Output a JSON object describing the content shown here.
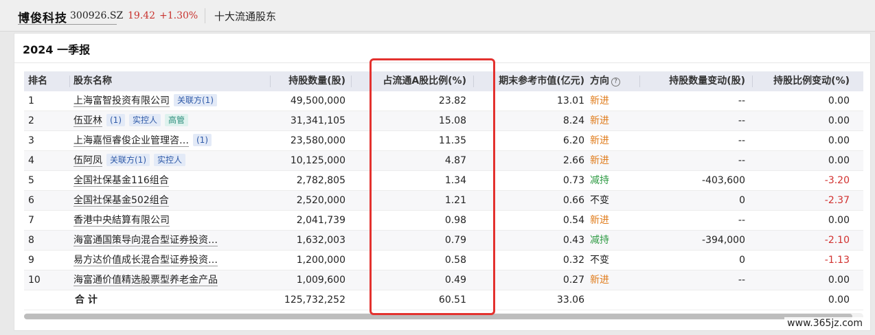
{
  "stock": {
    "name": "博俊科技",
    "code": "300926.SZ",
    "price": "19.42",
    "change": "+1.30%",
    "section": "十大流通股东"
  },
  "report": {
    "title": "2024 一季报"
  },
  "columns": {
    "rank": "排名",
    "name": "股东名称",
    "qty": "持股数量(股)",
    "pct": "占流通A股比例(%)",
    "mv": "期末参考市值(亿元)",
    "dir": "方向",
    "qchg": "持股数量变动(股)",
    "pchg": "持股比例变动(%)"
  },
  "rows": [
    {
      "rank": "1",
      "name": "上海富智投资有限公司",
      "tags": [
        {
          "text": "关联方(1)",
          "style": "blue"
        }
      ],
      "qty": "49,500,000",
      "pct": "23.82",
      "mv": "13.01",
      "dir": "新进",
      "dir_color": "#e07b1a",
      "qchg": "--",
      "pchg": "0.00",
      "pchg_neg": false
    },
    {
      "rank": "2",
      "name": "伍亚林",
      "tags": [
        {
          "text": "(1)",
          "style": "blue"
        },
        {
          "text": "实控人",
          "style": "blue"
        },
        {
          "text": "高管",
          "style": "teal"
        }
      ],
      "qty": "31,341,105",
      "pct": "15.08",
      "mv": "8.24",
      "dir": "新进",
      "dir_color": "#e07b1a",
      "qchg": "--",
      "pchg": "0.00",
      "pchg_neg": false
    },
    {
      "rank": "3",
      "name": "上海嘉恒睿俊企业管理咨…",
      "tags": [
        {
          "text": "(1)",
          "style": "blue"
        }
      ],
      "qty": "23,580,000",
      "pct": "11.35",
      "mv": "6.20",
      "dir": "新进",
      "dir_color": "#e07b1a",
      "qchg": "--",
      "pchg": "0.00",
      "pchg_neg": false
    },
    {
      "rank": "4",
      "name": "伍阿凤",
      "tags": [
        {
          "text": "关联方(1)",
          "style": "blue"
        },
        {
          "text": "实控人",
          "style": "blue"
        }
      ],
      "qty": "10,125,000",
      "pct": "4.87",
      "mv": "2.66",
      "dir": "新进",
      "dir_color": "#e07b1a",
      "qchg": "--",
      "pchg": "0.00",
      "pchg_neg": false
    },
    {
      "rank": "5",
      "name": "全国社保基金116组合",
      "tags": [],
      "qty": "2,782,805",
      "pct": "1.34",
      "mv": "0.73",
      "dir": "减持",
      "dir_color": "#2e9a43",
      "qchg": "-403,600",
      "pchg": "-3.20",
      "pchg_neg": true
    },
    {
      "rank": "6",
      "name": "全国社保基金502组合",
      "tags": [],
      "qty": "2,520,000",
      "pct": "1.21",
      "mv": "0.66",
      "dir": "不变",
      "dir_color": "#222222",
      "qchg": "0",
      "pchg": "-2.37",
      "pchg_neg": true
    },
    {
      "rank": "7",
      "name": "香港中央結算有限公司",
      "tags": [],
      "qty": "2,041,739",
      "pct": "0.98",
      "mv": "0.54",
      "dir": "新进",
      "dir_color": "#e07b1a",
      "qchg": "--",
      "pchg": "0.00",
      "pchg_neg": false
    },
    {
      "rank": "8",
      "name": "海富通国策导向混合型证券投资…",
      "tags": [],
      "qty": "1,632,003",
      "pct": "0.79",
      "mv": "0.43",
      "dir": "减持",
      "dir_color": "#2e9a43",
      "qchg": "-394,000",
      "pchg": "-2.10",
      "pchg_neg": true
    },
    {
      "rank": "9",
      "name": "易方达价值成长混合型证券投资…",
      "tags": [],
      "qty": "1,200,000",
      "pct": "0.58",
      "mv": "0.32",
      "dir": "不变",
      "dir_color": "#222222",
      "qchg": "0",
      "pchg": "-1.13",
      "pchg_neg": true
    },
    {
      "rank": "10",
      "name": "海富通价值精选股票型养老金产品",
      "tags": [],
      "qty": "1,009,600",
      "pct": "0.49",
      "mv": "0.27",
      "dir": "新进",
      "dir_color": "#e07b1a",
      "qchg": "--",
      "pchg": "0.00",
      "pchg_neg": false
    }
  ],
  "total": {
    "label": "合 计",
    "qty": "125,732,252",
    "pct": "60.51",
    "mv": "33.06",
    "pchg": "0.00"
  },
  "watermark": "www.365jz.com",
  "colors": {
    "price_up": "#c8322e",
    "direction_new": "#e07b1a",
    "direction_reduce": "#2e9a43",
    "negative": "#d1302e",
    "highlight": "#e3312e",
    "header_bg": "#e7e9f1"
  }
}
